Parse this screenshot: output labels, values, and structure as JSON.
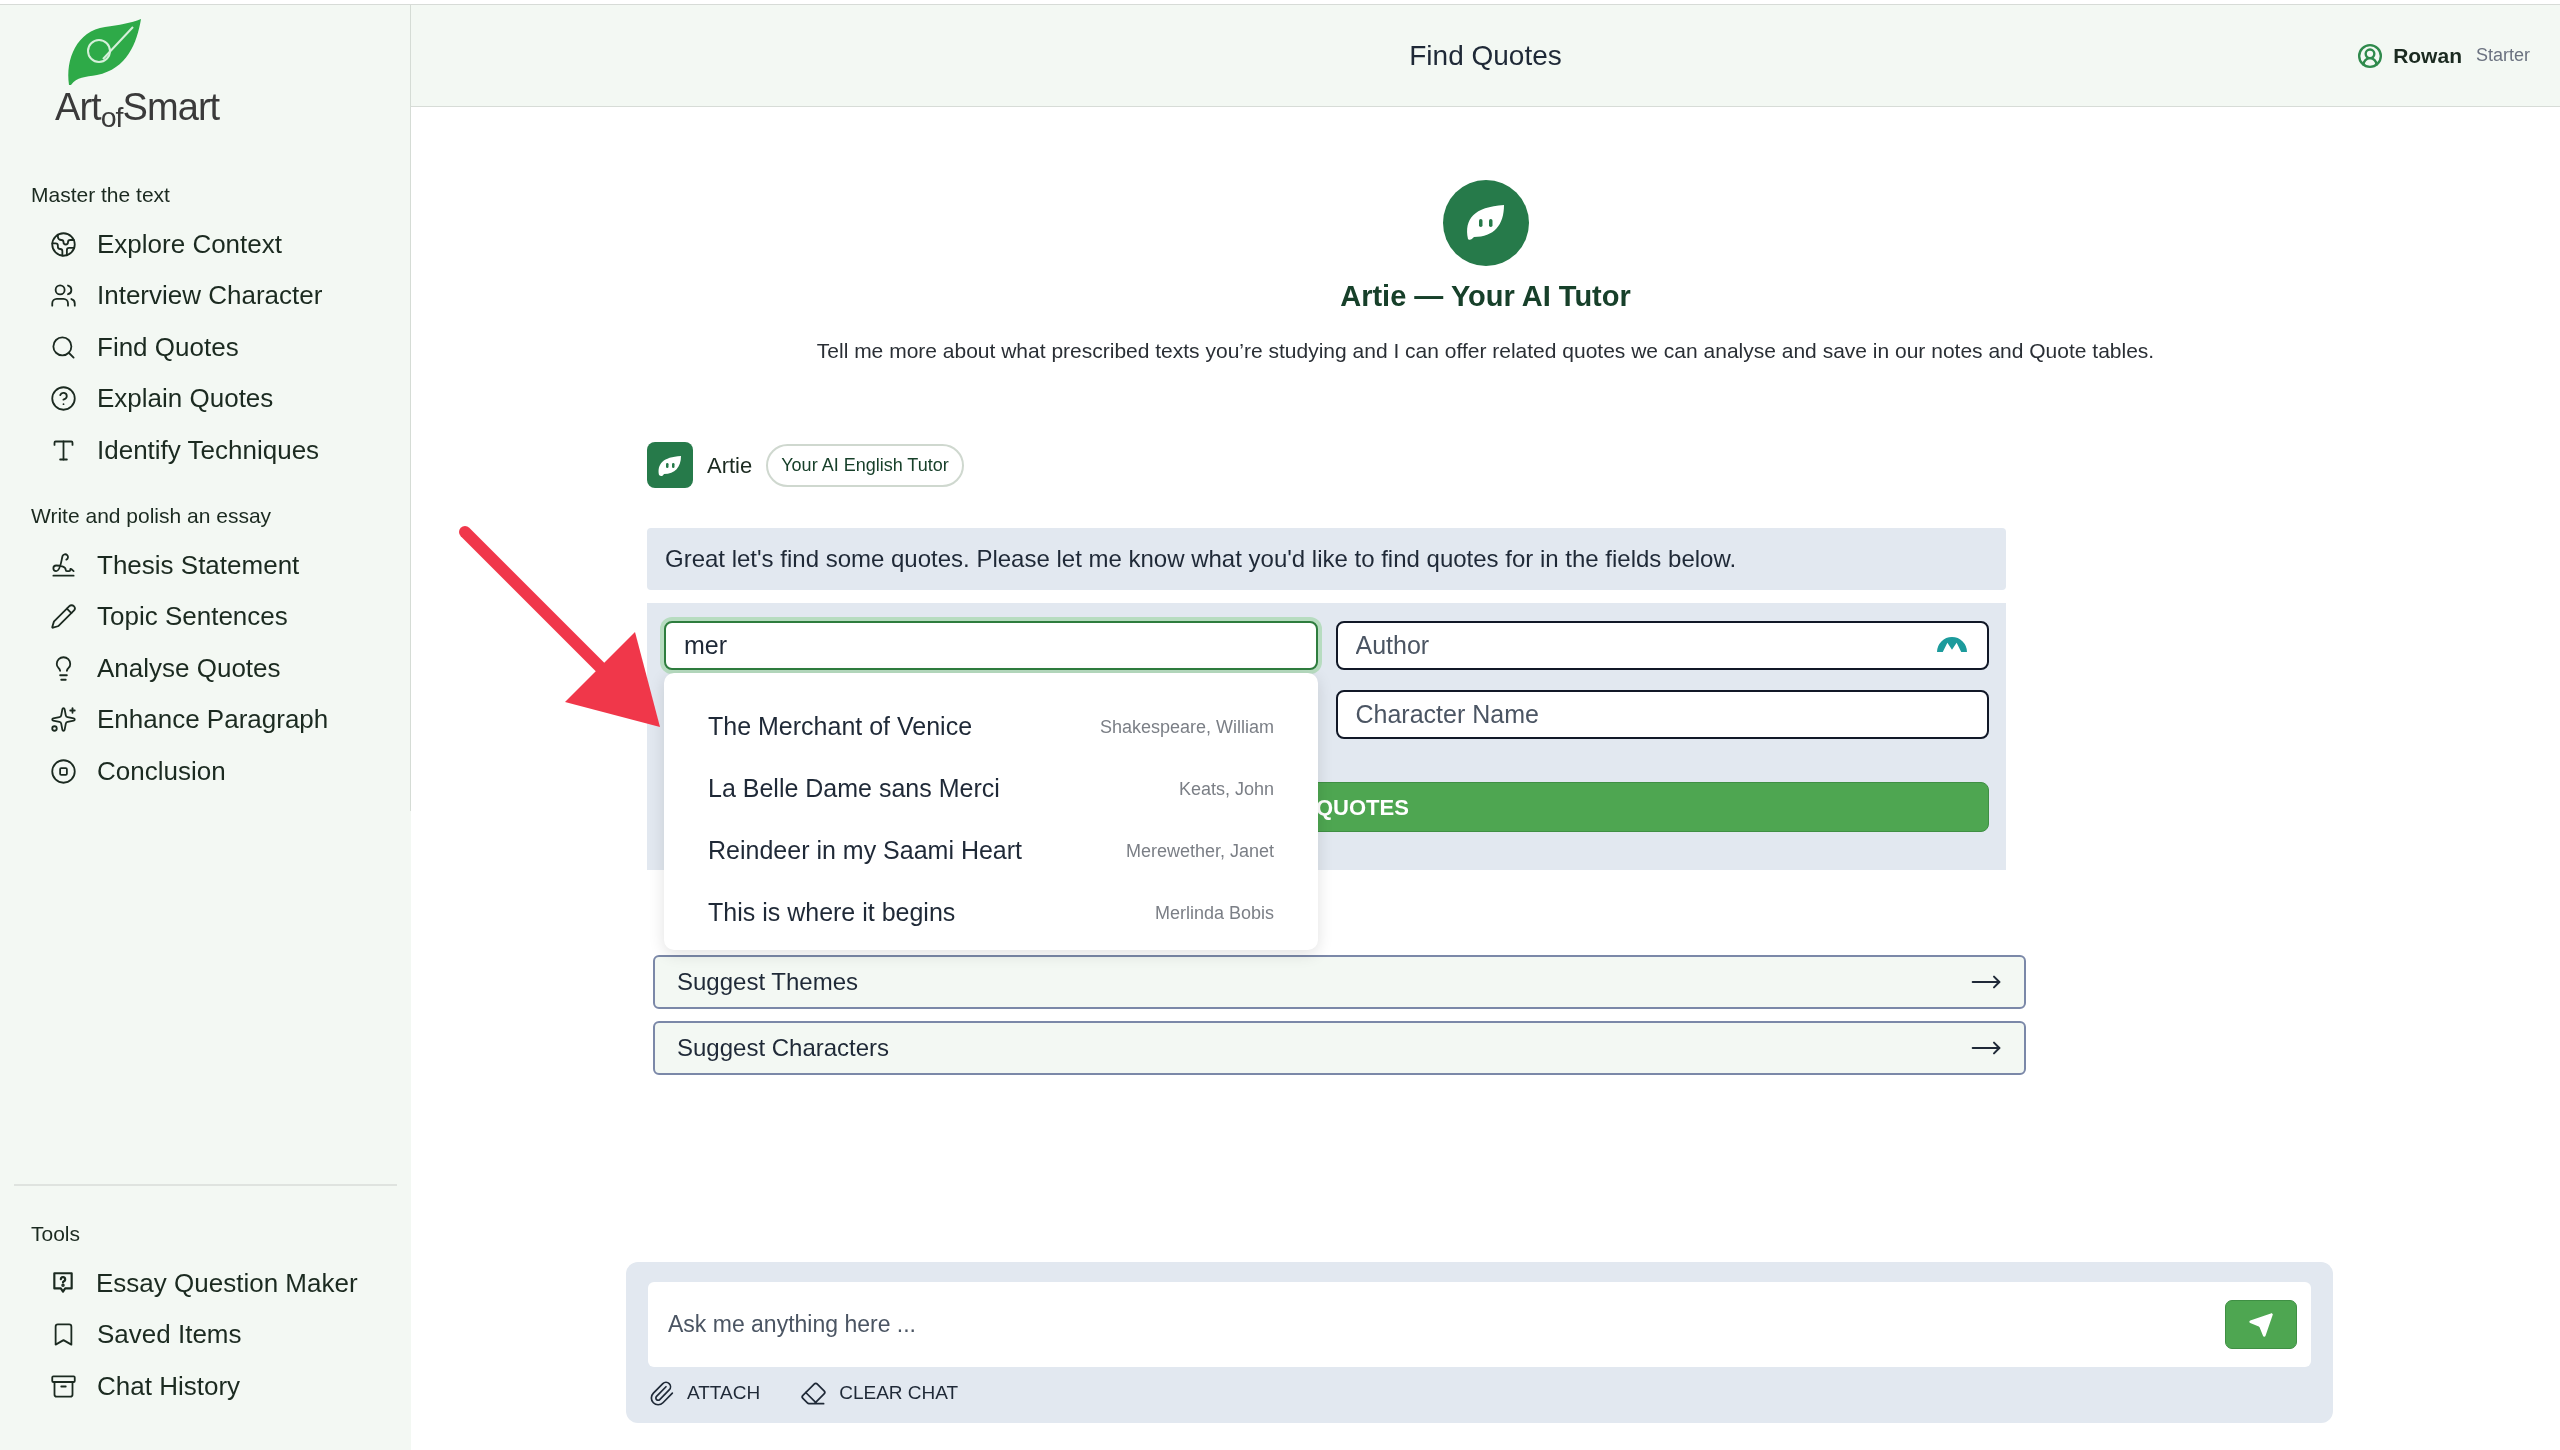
{
  "logo": {
    "text": "Art$_{of}$Smart"
  },
  "sidebar": {
    "sections": [
      {
        "title": "Master the text",
        "items": [
          {
            "label": "Explore Context"
          },
          {
            "label": "Interview Character"
          },
          {
            "label": "Find Quotes"
          },
          {
            "label": "Explain Quotes"
          },
          {
            "label": "Identify Techniques"
          }
        ]
      },
      {
        "title": "Write and polish an essay",
        "items": [
          {
            "label": "Thesis Statement"
          },
          {
            "label": "Topic Sentences"
          },
          {
            "label": "Analyse Quotes"
          },
          {
            "label": "Enhance Paragraph"
          },
          {
            "label": "Conclusion"
          }
        ]
      }
    ],
    "tools": {
      "title": "Tools",
      "items": [
        {
          "label": "Essay Question Maker"
        },
        {
          "label": "Saved Items"
        },
        {
          "label": "Chat History"
        }
      ]
    }
  },
  "header": {
    "title": "Find Quotes",
    "user": "Rowan",
    "plan": "Starter"
  },
  "intro": {
    "title": "Artie — Your AI Tutor",
    "text": "Tell me more about what prescribed texts you’re studying and I can offer related quotes we can analyse and save in our notes and Quote tables."
  },
  "chat": {
    "sender": "Artie",
    "badge": "Your AI English Tutor",
    "message": "Great let's find some quotes. Please let me know what you'd like to find quotes for in the fields below."
  },
  "form": {
    "fields": [
      {
        "value": "mer",
        "focused": true,
        "loading": false
      },
      {
        "placeholder": "Author",
        "focused": false,
        "loading": true
      },
      {
        "placeholder": "Character Name",
        "focused": false,
        "loading": false
      }
    ],
    "button": "QUOTES",
    "suggestions": [
      {
        "title": "The Merchant of Venice",
        "author": "Shakespeare, William"
      },
      {
        "title": "La Belle Dame sans Merci",
        "author": "Keats, John"
      },
      {
        "title": "Reindeer in my Saami Heart",
        "author": "Merewether, Janet"
      },
      {
        "title": "This is where it begins",
        "author": "Merlinda Bobis"
      }
    ]
  },
  "suggest_buttons": [
    "Suggest Themes",
    "Suggest Characters"
  ],
  "composer": {
    "placeholder": "Ask me anything here ...",
    "actions": [
      "ATTACH",
      "CLEAR CHAT"
    ]
  }
}
